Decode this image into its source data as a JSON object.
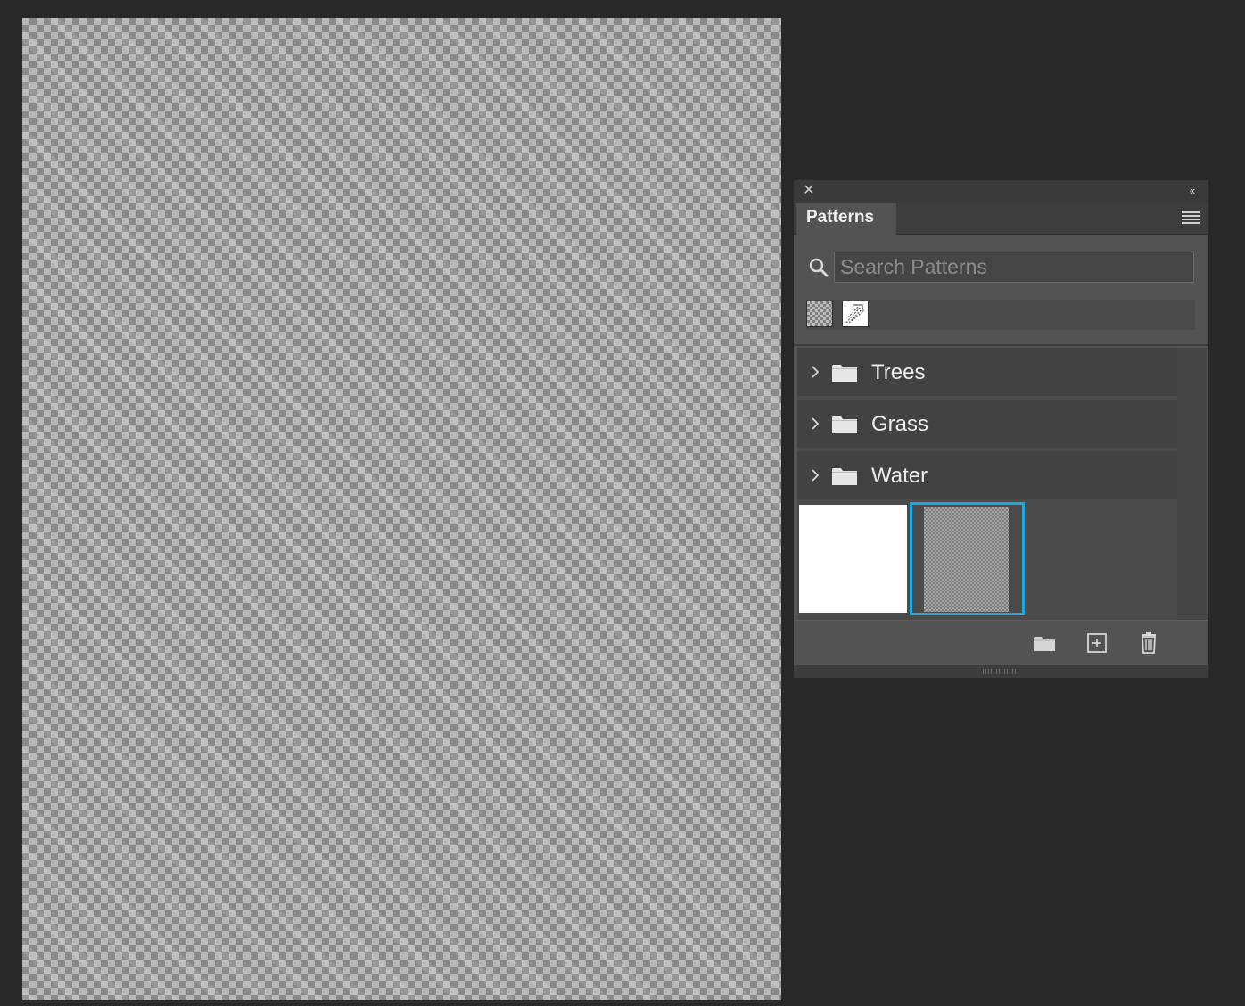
{
  "panel": {
    "title": "Patterns",
    "close_icon": "close-icon",
    "collapse_icon": "collapse-double-chevron-icon",
    "menu_icon": "hamburger-menu-icon"
  },
  "search": {
    "placeholder": "Search Patterns",
    "value": "",
    "icon": "search-icon"
  },
  "recent_patterns": [
    {
      "name": "checkerboard-pattern",
      "icon": "checker-swatch"
    },
    {
      "name": "sketch-pattern",
      "icon": "sketch-swatch"
    }
  ],
  "groups": [
    {
      "label": "Trees",
      "icon": "folder-icon",
      "expanded": false
    },
    {
      "label": "Grass",
      "icon": "folder-icon",
      "expanded": false
    },
    {
      "label": "Water",
      "icon": "folder-icon",
      "expanded": false
    }
  ],
  "patterns": [
    {
      "name": "white-pattern",
      "selected": false
    },
    {
      "name": "transparent-checker-pattern",
      "selected": true
    }
  ],
  "footer": {
    "new_group_icon": "new-folder-icon",
    "new_pattern_icon": "add-square-icon",
    "delete_icon": "trash-icon"
  },
  "colors": {
    "app_background": "#282828",
    "panel_background": "#535353",
    "selection_accent": "#1ea7e0",
    "text": "#ececec"
  }
}
